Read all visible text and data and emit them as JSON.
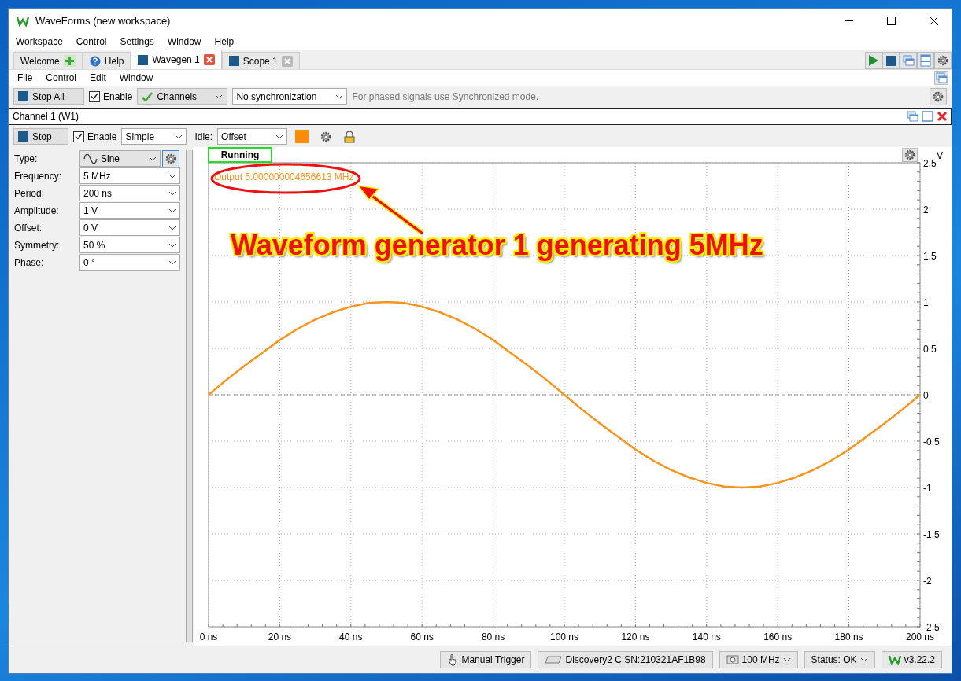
{
  "window": {
    "title": "WaveForms (new workspace)"
  },
  "menu": [
    "Workspace",
    "Control",
    "Settings",
    "Window",
    "Help"
  ],
  "tabs": [
    {
      "label": "Welcome",
      "kind": "add",
      "selected": false
    },
    {
      "label": "Help",
      "kind": "help",
      "selected": false
    },
    {
      "label": "Wavegen 1",
      "kind": "doc",
      "selected": true
    },
    {
      "label": "Scope 1",
      "kind": "doc",
      "selected": false
    }
  ],
  "submenu": [
    "File",
    "Control",
    "Edit",
    "Window"
  ],
  "toolbar": {
    "stop_all": "Stop All",
    "enable": {
      "label": "Enable",
      "checked": true
    },
    "channels": "Channels",
    "sync": "No synchronization",
    "hint": "For phased signals use Synchronized mode."
  },
  "channel": {
    "title": "Channel 1 (W1)",
    "stop": "Stop",
    "enable": {
      "label": "Enable",
      "checked": true
    },
    "mode": "Simple",
    "idle_label": "Idle:",
    "idle": "Offset",
    "color": "#ff8c00"
  },
  "params": [
    {
      "label": "Type:",
      "value": "Sine",
      "kind": "type"
    },
    {
      "label": "Frequency:",
      "value": "5 MHz",
      "kind": "value"
    },
    {
      "label": "Period:",
      "value": "200 ns",
      "kind": "value"
    },
    {
      "label": "Amplitude:",
      "value": "1 V",
      "kind": "value"
    },
    {
      "label": "Offset:",
      "value": "0 V",
      "kind": "value"
    },
    {
      "label": "Symmetry:",
      "value": "50 %",
      "kind": "value"
    },
    {
      "label": "Phase:",
      "value": "0 °",
      "kind": "value"
    }
  ],
  "plot": {
    "status": "Running",
    "output": "Output 5.000000004656613 MHz",
    "callout": "Waveform generator 1 generating 5MHz",
    "chart_data": {
      "type": "line",
      "ylabel": "V",
      "x": [
        0,
        5,
        10,
        15,
        20,
        25,
        30,
        35,
        40,
        45,
        50,
        55,
        60,
        65,
        70,
        75,
        80,
        85,
        90,
        95,
        100,
        105,
        110,
        115,
        120,
        125,
        130,
        135,
        140,
        145,
        150,
        155,
        160,
        165,
        170,
        175,
        180,
        185,
        190,
        195,
        200
      ],
      "series": [
        {
          "color": "#f7941d",
          "values": [
            0,
            0.16,
            0.31,
            0.45,
            0.59,
            0.71,
            0.81,
            0.89,
            0.95,
            0.99,
            1,
            0.99,
            0.95,
            0.89,
            0.81,
            0.71,
            0.59,
            0.45,
            0.31,
            0.16,
            0,
            -0.16,
            -0.31,
            -0.45,
            -0.59,
            -0.71,
            -0.81,
            -0.89,
            -0.95,
            -0.99,
            -1,
            -0.99,
            -0.95,
            -0.89,
            -0.81,
            -0.71,
            -0.59,
            -0.45,
            -0.31,
            -0.16,
            0
          ]
        }
      ],
      "grid": true,
      "ref_lines": [
        {
          "axis": "y",
          "value": 0
        }
      ],
      "xlim": [
        0,
        200
      ],
      "ylim": [
        -2.5,
        2.5
      ],
      "xticks": [
        {
          "value": 0,
          "label": "0 ns"
        },
        {
          "value": 20,
          "label": "20 ns"
        },
        {
          "value": 40,
          "label": "40 ns"
        },
        {
          "value": 60,
          "label": "60 ns"
        },
        {
          "value": 80,
          "label": "80 ns"
        },
        {
          "value": 100,
          "label": "100 ns"
        },
        {
          "value": 120,
          "label": "120 ns"
        },
        {
          "value": 140,
          "label": "140 ns"
        },
        {
          "value": 160,
          "label": "160 ns"
        },
        {
          "value": 180,
          "label": "180 ns"
        },
        {
          "value": 200,
          "label": "200 ns"
        }
      ],
      "yticks": [
        2.5,
        2,
        1.5,
        1,
        0.5,
        0,
        -0.5,
        -1,
        -1.5,
        -2,
        -2.5
      ]
    }
  },
  "status_bar": [
    {
      "label": "Manual Trigger",
      "kind": "trigger"
    },
    {
      "label": "Discovery2 C SN:210321AF1B98",
      "kind": "device"
    },
    {
      "label": "100 MHz",
      "kind": "clock"
    },
    {
      "label": "Status: OK",
      "kind": "status"
    },
    {
      "label": "v3.22.2",
      "kind": "version"
    }
  ]
}
